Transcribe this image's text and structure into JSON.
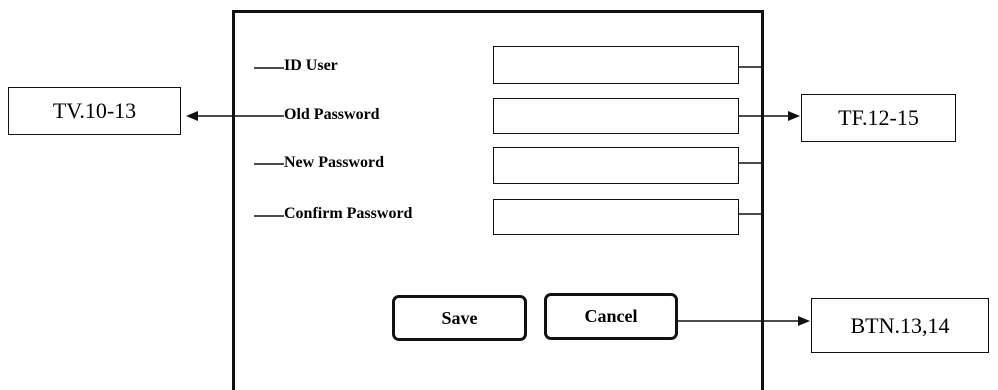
{
  "form": {
    "fields": [
      {
        "label": "ID User",
        "value": ""
      },
      {
        "label": "Old Password",
        "value": ""
      },
      {
        "label": "New Password",
        "value": ""
      },
      {
        "label": "Confirm Password",
        "value": ""
      }
    ],
    "save_label": "Save",
    "cancel_label": "Cancel"
  },
  "annotations": {
    "labels_tag": "TV.10-13",
    "fields_tag": "TF.12-15",
    "buttons_tag": "BTN.13,14"
  }
}
